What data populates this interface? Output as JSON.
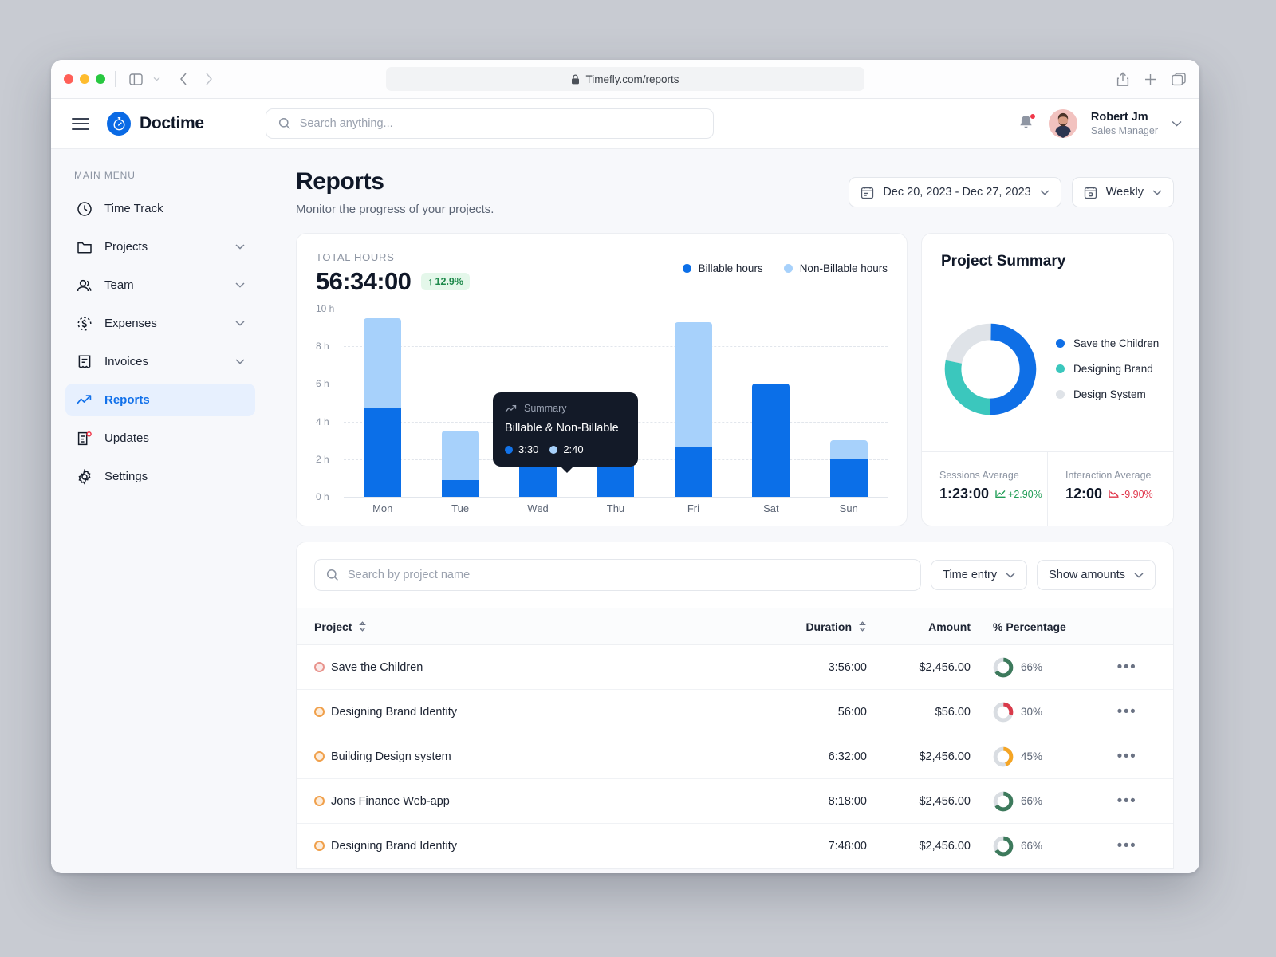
{
  "browser": {
    "url": "Timefly.com/reports",
    "lock_icon": "lock-icon",
    "back_icon": "chevron-left-icon",
    "forward_icon": "chevron-right-icon",
    "sidebar_toggle_icon": "sidebar-toggle-icon",
    "share_icon": "share-icon",
    "new_tab_icon": "plus-icon",
    "tabs_icon": "tabs-icon"
  },
  "app": {
    "brand": "Doctime",
    "menu_icon": "hamburger-menu-icon",
    "logo_icon": "stopwatch-logo-icon",
    "search_placeholder": "Search anything...",
    "search_value": "",
    "search_icon": "search-icon",
    "notification_icon": "bell-icon",
    "user": {
      "name": "Robert Jm",
      "role": "Sales Manager",
      "chevron": "chevron-down-icon"
    }
  },
  "sidebar": {
    "section_label": "MAIN MENU",
    "items": [
      {
        "label": "Time Track",
        "icon": "clock-icon",
        "expandable": false,
        "active": false
      },
      {
        "label": "Projects",
        "icon": "folder-icon",
        "expandable": true,
        "active": false
      },
      {
        "label": "Team",
        "icon": "users-icon",
        "expandable": true,
        "active": false
      },
      {
        "label": "Expenses",
        "icon": "dollar-circle-icon",
        "expandable": true,
        "active": false
      },
      {
        "label": "Invoices",
        "icon": "invoice-icon",
        "expandable": true,
        "active": false
      },
      {
        "label": "Reports",
        "icon": "trend-up-icon",
        "expandable": false,
        "active": true
      },
      {
        "label": "Updates",
        "icon": "updates-icon",
        "expandable": false,
        "active": false
      },
      {
        "label": "Settings",
        "icon": "gear-icon",
        "expandable": false,
        "active": false
      }
    ]
  },
  "page": {
    "title": "Reports",
    "subtitle": "Monitor the progress of your projects.",
    "date_range": "Dec 20, 2023 - Dec 27, 2023",
    "date_range_icon": "calendar-icon",
    "period": "Weekly",
    "period_icon": "calendar-week-icon",
    "chevron": "chevron-down-icon"
  },
  "total_hours_card": {
    "label": "TOTAL HOURS",
    "value": "56:34:00",
    "delta": "12.9%",
    "delta_arrow": "↑",
    "legend": [
      {
        "label": "Billable hours",
        "color": "#0b6fe8"
      },
      {
        "label": "Non-Billable hours",
        "color": "#a7d1fb"
      }
    ]
  },
  "tooltip": {
    "icon": "trend-up-icon",
    "head": "Summary",
    "title": "Billable & Non-Billable",
    "billable": "3:30",
    "nonbillable": "2:40",
    "billable_color": "#1273ea",
    "nonbillable_color": "#a7d1fb"
  },
  "chart_data": {
    "type": "bar",
    "title": "Total Hours",
    "stacked": true,
    "categories": [
      "Mon",
      "Tue",
      "Wed",
      "Thu",
      "Fri",
      "Sat",
      "Sun"
    ],
    "series": [
      {
        "name": "Billable hours",
        "color": "#0b6fe8",
        "values": [
          4.7,
          0.9,
          3.35,
          3.8,
          2.65,
          6.0,
          2.05
        ]
      },
      {
        "name": "Non-Billable hours",
        "color": "#a7d1fb",
        "values": [
          4.8,
          2.6,
          1.85,
          0.3,
          6.65,
          0.0,
          0.95
        ]
      }
    ],
    "totals": [
      9.5,
      3.5,
      5.2,
      4.1,
      9.3,
      6.0,
      3.0
    ],
    "ylabel": "",
    "xlabel": "",
    "ylim": [
      0,
      10
    ],
    "yticks": [
      "0 h",
      "2 h",
      "4 h",
      "6 h",
      "8 h",
      "10 h"
    ],
    "ytick_values": [
      0,
      2,
      4,
      6,
      8,
      10
    ],
    "grid": true,
    "legend_position": "top-right"
  },
  "project_summary": {
    "title": "Project Summary",
    "donut": {
      "type": "pie",
      "slices": [
        {
          "label": "Save the Children",
          "value": 50,
          "color": "#0f6fe6"
        },
        {
          "label": "Designing Brand",
          "value": 28,
          "color": "#3bc7bd"
        },
        {
          "label": "Design System",
          "value": 22,
          "color": "#dfe3e8"
        }
      ]
    },
    "stats": [
      {
        "label": "Sessions Average",
        "value": "1:23:00",
        "delta": "+2.90%",
        "direction": "up",
        "icon": "trend-up-icon"
      },
      {
        "label": "Interaction Average",
        "value": "12:00",
        "delta": "-9.90%",
        "direction": "down",
        "icon": "trend-down-icon"
      }
    ]
  },
  "table": {
    "search_placeholder": "Search by project name",
    "search_value": "",
    "search_icon": "search-icon",
    "filters": [
      {
        "label": "Time entry",
        "chevron": "chevron-down-icon"
      },
      {
        "label": "Show amounts",
        "chevron": "chevron-down-icon"
      }
    ],
    "columns": [
      {
        "label": "Project",
        "sortable": true,
        "sort_icon": "sort-icon"
      },
      {
        "label": "Duration",
        "sortable": true,
        "sort_icon": "sort-icon"
      },
      {
        "label": "Amount",
        "sortable": false
      },
      {
        "label": "% Percentage",
        "sortable": false
      }
    ],
    "rows": [
      {
        "project": "Save the Children",
        "dot_color": "#e8938c",
        "duration": "3:56:00",
        "amount": "$2,456.00",
        "percent": "66%",
        "percent_value": 66,
        "ring_color": "#3d7a5c"
      },
      {
        "project": "Designing Brand Identity",
        "dot_color": "#f0a04b",
        "duration": "56:00",
        "amount": "$56.00",
        "percent": "30%",
        "percent_value": 30,
        "ring_color": "#d93a4a"
      },
      {
        "project": "Building Design system",
        "dot_color": "#f0a04b",
        "duration": "6:32:00",
        "amount": "$2,456.00",
        "percent": "45%",
        "percent_value": 45,
        "ring_color": "#f5a524"
      },
      {
        "project": "Jons Finance Web-app",
        "dot_color": "#f0a04b",
        "duration": "8:18:00",
        "amount": "$2,456.00",
        "percent": "66%",
        "percent_value": 66,
        "ring_color": "#3d7a5c"
      },
      {
        "project": "Designing Brand Identity",
        "dot_color": "#f0a04b",
        "duration": "7:48:00",
        "amount": "$2,456.00",
        "percent": "66%",
        "percent_value": 66,
        "ring_color": "#3d7a5c"
      }
    ],
    "row_action_icon": "ellipsis-icon",
    "row_action_label": "•••"
  }
}
